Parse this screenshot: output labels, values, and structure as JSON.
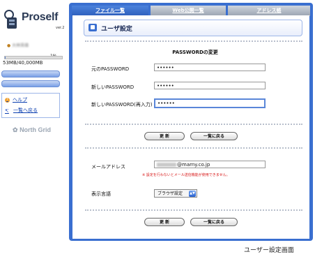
{
  "sidebar": {
    "app_name": "Proself",
    "version": "ver.2",
    "user_name": "大林英雄",
    "quota_percent": 1,
    "quota_percent_label": "1%",
    "quota_text": "53MB/40,000MB",
    "links": [
      {
        "label": "ヘルプ",
        "icon": "help-icon"
      },
      {
        "label": "一覧へ戻る",
        "icon": "back-arrow-icon"
      }
    ],
    "brand": "North Grid"
  },
  "tabs": [
    {
      "label": "ファイル一覧",
      "active": true
    },
    {
      "label": "Web公開一覧",
      "active": false
    },
    {
      "label": "アドレス帳",
      "active": false
    }
  ],
  "page_header": {
    "title": "ユーザ設定"
  },
  "password_section": {
    "title": "PASSWORDの変更",
    "fields": [
      {
        "label": "元のPASSWORD",
        "value": "••••••"
      },
      {
        "label": "新しいPASSWORD",
        "value": "••••••"
      },
      {
        "label": "新しいPASSWORD(再入力)",
        "value": "••••••"
      }
    ],
    "buttons": {
      "update": "更 新",
      "back": "一覧に戻る"
    }
  },
  "settings_section": {
    "email_label": "メールアドレス",
    "email_value": "@marny.co.jp",
    "warning": "※ 設定を行わないとメール送信機能が使用できません。",
    "language_label": "表示言語",
    "language_value": "ブラウザ設定",
    "buttons": {
      "update": "更 新",
      "back": "一覧に戻る"
    }
  },
  "caption": "ユーザー設定画面",
  "colors": {
    "accent": "#3a6fd0",
    "warning": "#d81818"
  }
}
